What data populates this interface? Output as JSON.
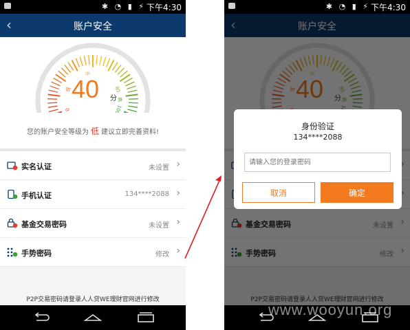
{
  "status": {
    "time": "下午4:30",
    "icons": "✱ ◔ ▮ ⚡"
  },
  "header": {
    "title": "账户安全",
    "back_icon": "chevron-left-icon"
  },
  "gauge": {
    "score": "40",
    "unit": "分",
    "value_fraction": 0.4,
    "tick_labels": [
      "0",
      "低",
      "中",
      "80",
      "高",
      "100"
    ],
    "colors": {
      "low": "#e63c2f",
      "mid": "#f5c518",
      "high": "#3aa33a",
      "track": "#e2e2e2"
    }
  },
  "hint": {
    "prefix": "您的账户安全等级为",
    "level": "低",
    "suffix": "建议立即完善资料!"
  },
  "settings": [
    {
      "label": "实名认证",
      "value": "未设置",
      "icon": "id-card-warning-icon"
    },
    {
      "label": "手机认证",
      "value": "134****2088",
      "icon": "phone-verified-icon"
    },
    {
      "label": "基金交易密码",
      "value": "未设置",
      "icon": "lock-warning-icon"
    },
    {
      "label": "手势密码",
      "value": "修改",
      "icon": "gesture-pattern-icon"
    }
  ],
  "footnote": "P2P交易密码请登录人人贷WE理财官网进行修改",
  "dialog": {
    "title": "身份验证",
    "phone": "134****2088",
    "input_placeholder": "请输入您的登录密码",
    "cancel_label": "取消",
    "confirm_label": "确定"
  },
  "watermark": "www.wooyun.org",
  "accent_color": "#f47a20",
  "brand_color": "#0d3a6c"
}
